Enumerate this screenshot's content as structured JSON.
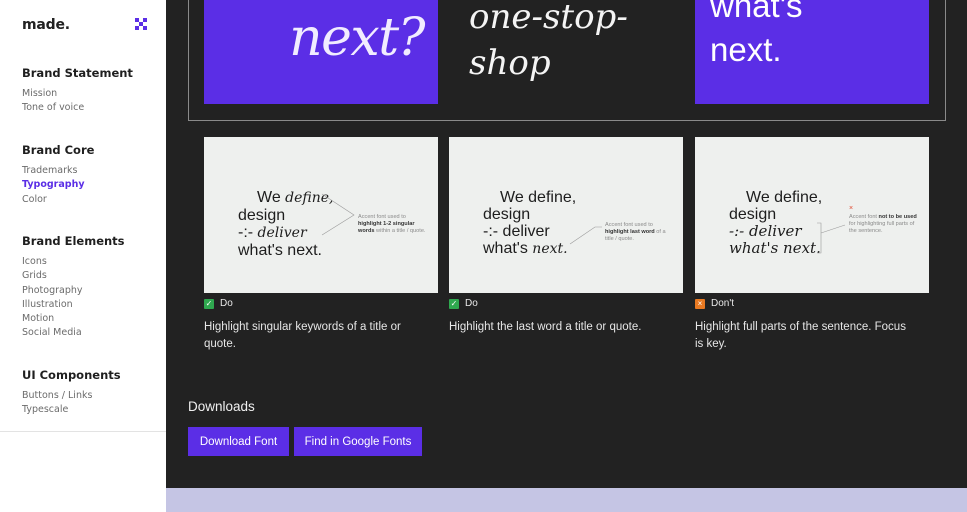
{
  "sidebar": {
    "logo": "made.",
    "groups": [
      {
        "title": "Brand Statement",
        "items": [
          "Mission",
          "Tone of voice"
        ]
      },
      {
        "title": "Brand Core",
        "items": [
          "Trademarks",
          "Typography",
          "Color"
        ],
        "active": "Typography"
      },
      {
        "title": "Brand Elements",
        "items": [
          "Icons",
          "Grids",
          "Photography",
          "Illustration",
          "Motion",
          "Social Media"
        ]
      },
      {
        "title": "UI Components",
        "items": [
          "Buttons / Links",
          "Typescale"
        ]
      }
    ]
  },
  "showcase": {
    "tile1_text": "next?",
    "tile2_line1": "one-stop-",
    "tile2_line2": "shop",
    "tile3_line1": "what's",
    "tile3_line2": "next."
  },
  "examples": [
    {
      "verdict": "Do",
      "caption": "Highlight singular keywords of a title or quote.",
      "headline": {
        "l1a": "We ",
        "l1b": "define,",
        "l2": "design",
        "l3a": "-:- ",
        "l3b": "deliver",
        "l4": "what's next."
      },
      "note": {
        "a": "Accent font used to ",
        "b": "highlight 1-2 singular words",
        "c": " within a title / quote."
      }
    },
    {
      "verdict": "Do",
      "caption": "Highlight the last word a title or quote.",
      "headline": {
        "l1": "We define,",
        "l2": "design",
        "l3": "-:- deliver",
        "l4a": "what's ",
        "l4b": "next."
      },
      "note": {
        "a": "Accent font used to ",
        "b": "highlight last word",
        "c": " of a title / quote."
      }
    },
    {
      "verdict": "Don't",
      "caption": "Highlight full parts of the sentence. Focus is key.",
      "headline": {
        "l1": "We define,",
        "l2": "design",
        "l3": "-:- deliver",
        "l4": "what's next."
      },
      "note": {
        "a": "Accent font ",
        "b": "not to be used",
        "c": " for highlighting full parts of the sentence."
      },
      "x": "×"
    }
  ],
  "downloads": {
    "title": "Downloads",
    "download_font": "Download Font",
    "google_fonts": "Find in Google Fonts"
  },
  "colors": {
    "accent": "#5b2ee6",
    "dark_bg": "#222222",
    "do": "#2fa84f",
    "dont": "#e97a22"
  }
}
